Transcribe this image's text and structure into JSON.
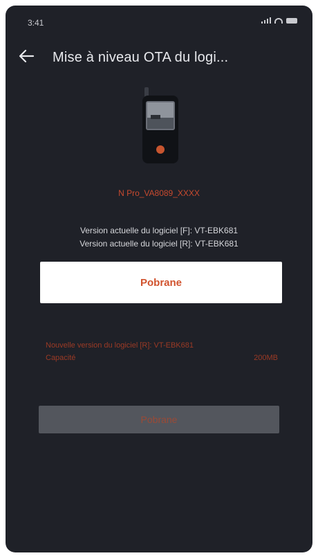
{
  "status_bar": {
    "time": "3:41"
  },
  "header": {
    "title": "Mise à niveau OTA du logi..."
  },
  "device": {
    "name": "N Pro_VA8089_XXXX"
  },
  "current_versions": [
    "Version actuelle du logiciel [F]: VT-EBK681",
    "Version actuelle du logiciel [R]: VT-EBK681"
  ],
  "primary_button": {
    "label": "Pobrane"
  },
  "new_version": {
    "label": "Nouvelle version du logiciel [R]: VT-EBK681",
    "capacity_label": "Capacité",
    "capacity_value": "200MB"
  },
  "secondary_button": {
    "label": "Pobrane"
  },
  "colors": {
    "background": "#1f2128",
    "accent": "#d1532e",
    "primary_button_bg": "#ffffff",
    "disabled_button_bg": "#53565d"
  }
}
